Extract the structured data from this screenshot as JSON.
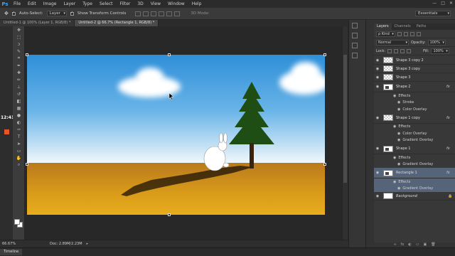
{
  "app": {
    "logo": "Ps",
    "menu": [
      "File",
      "Edit",
      "Image",
      "Layer",
      "Type",
      "Select",
      "Filter",
      "3D",
      "View",
      "Window",
      "Help"
    ],
    "window_controls": [
      "—",
      "□",
      "✕"
    ]
  },
  "options": {
    "auto_select_label": "Auto-Select:",
    "auto_select_value": "Layer",
    "transform_label": "Show Transform Controls",
    "mode_3d": "3D Mode:",
    "workspace": "Essentials"
  },
  "doc_tabs": [
    "Untitled-1 @ 100% (Layer 1, RGB/8) *",
    "Untitled-2 @ 66.7% (Rectangle 1, RGB/8) *"
  ],
  "clock": "12:41",
  "status": {
    "zoom": "66.67%",
    "doc": "Doc: 2.89M/2.23M",
    "arrow": "▸"
  },
  "timeline": "Timeline",
  "panel": {
    "tabs": [
      "Layers",
      "Channels",
      "Paths"
    ],
    "kind_label": "ρ Kind",
    "blend_mode": "Normal",
    "opacity_label": "Opacity:",
    "opacity_value": "100%",
    "lock_label": "Lock:",
    "fill_label": "Fill:",
    "fill_value": "100%",
    "layers": {
      "shape3copy2": "Shape 3 copy 2",
      "shape3copy": "Shape 3 copy",
      "shape3": "Shape 3",
      "shape2": "Shape 2",
      "shape1copy": "Shape 1 copy",
      "shape1": "Shape 1",
      "rect1": "Rectangle 1",
      "background": "Background"
    },
    "effects_label": "Effects",
    "effects": {
      "stroke": "Stroke",
      "color_overlay": "Color Overlay",
      "gradient_overlay": "Gradient Overlay"
    },
    "fx": "fx",
    "eye": "◉",
    "lock_icon": "🔒",
    "footer": [
      "∞",
      "fx",
      "◐",
      "▭",
      "▣",
      "🗑"
    ]
  }
}
